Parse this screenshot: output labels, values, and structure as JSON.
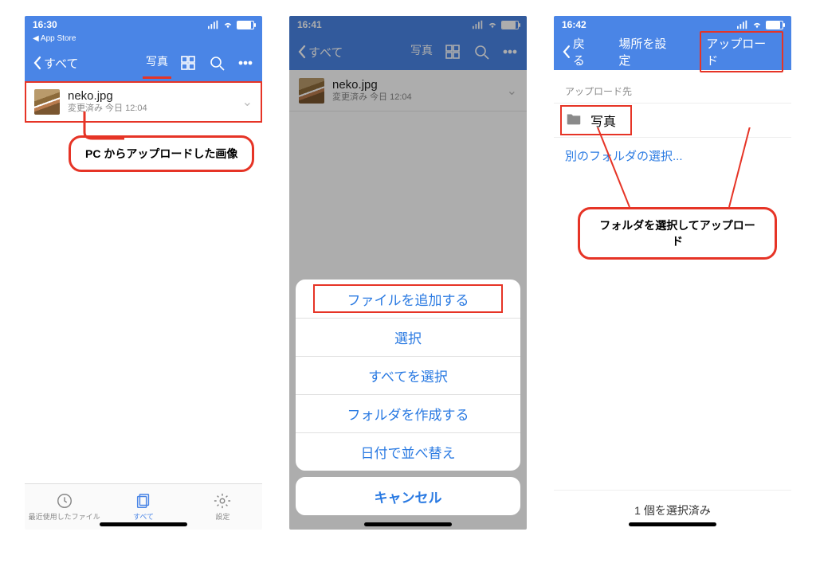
{
  "screen1": {
    "status_time": "16:30",
    "back_app": "App Store",
    "nav_back": "すべて",
    "nav_tab": "写真",
    "file": {
      "name": "neko.jpg",
      "meta": "変更済み 今日 12:04"
    },
    "tabs": {
      "recent": "最近使用したファイル",
      "all": "すべて",
      "settings": "設定"
    }
  },
  "screen2": {
    "status_time": "16:41",
    "nav_back": "すべて",
    "nav_tab": "写真",
    "file": {
      "name": "neko.jpg",
      "meta": "変更済み 今日 12:04"
    },
    "options": {
      "add_file": "ファイルを追加する",
      "select": "選択",
      "select_all": "すべてを選択",
      "create_folder": "フォルダを作成する",
      "sort_date": "日付で並べ替え"
    },
    "cancel": "キャンセル"
  },
  "screen3": {
    "status_time": "16:42",
    "nav_back": "戻る",
    "nav_center": "場所を設定",
    "nav_right": "アップロード",
    "section_label": "アップロード先",
    "folder": "写真",
    "choose_other": "別のフォルダの選択...",
    "bottom_status": "1 個を選択済み"
  },
  "callouts": {
    "c1": "PC からアップロードした画像",
    "c2": "フォルダを選択してアップロード"
  }
}
